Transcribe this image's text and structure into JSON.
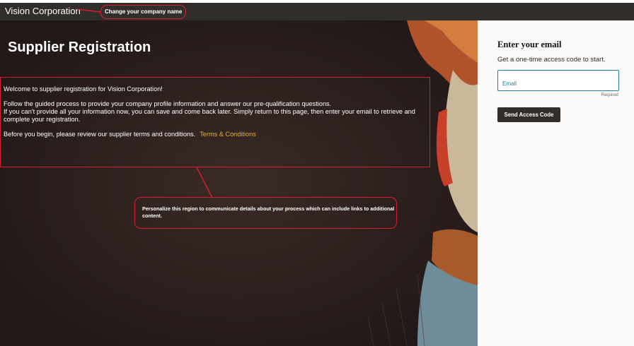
{
  "header": {
    "company_name": "Vision Corporation",
    "company_callout": "Change your company name"
  },
  "hero": {
    "title": "Supplier Registration",
    "welcome": "Welcome to supplier registration for Vision Corporation!",
    "process_line1": "Follow the guided process to provide your company profile information and answer our pre-qualification questions.",
    "process_line2": "If you can't provide all your information now, you can save and come back later. Simply return to this page, then enter your email to retrieve and complete your registration.",
    "terms_prefix": "Before you begin, please review our supplier terms and conditions.",
    "terms_link": "Terms & Conditions",
    "region_callout": "Personalize this region to communicate details about your process which can include links to additional content."
  },
  "email_panel": {
    "title": "Enter your email",
    "subtitle": "Get a one-time access code to start.",
    "email_placeholder": "Email",
    "required_label": "Required",
    "send_button": "Send Access Code"
  },
  "colors": {
    "header_bg": "#312d2a",
    "hero_bg": "#2a1f1d",
    "callout_border": "#d3202e",
    "link": "#e9b232",
    "field_accent": "#227e9e",
    "button_bg": "#312d2a"
  }
}
